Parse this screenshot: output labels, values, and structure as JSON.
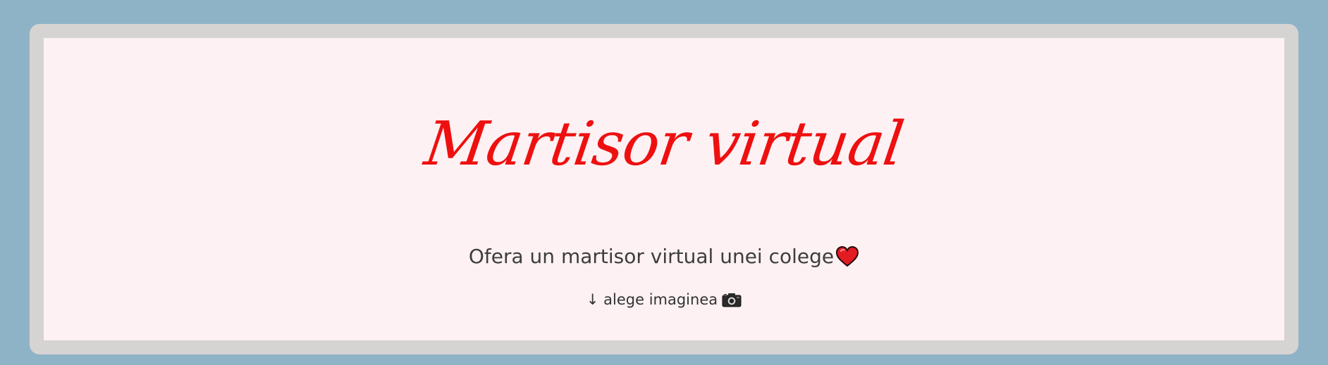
{
  "header": {
    "title": "Martisor virtual"
  },
  "main": {
    "subtitle": "Ofera un martisor virtual unei colege",
    "subtitle_icon": "heart-icon",
    "hint": "↓ alege imaginea",
    "hint_icon": "camera-icon"
  },
  "colors": {
    "page_background": "#8fb3c6",
    "frame": "#d6d3d3",
    "card_background": "#fdf1f3",
    "title": "#ee1010",
    "text": "#3d3d3d"
  }
}
